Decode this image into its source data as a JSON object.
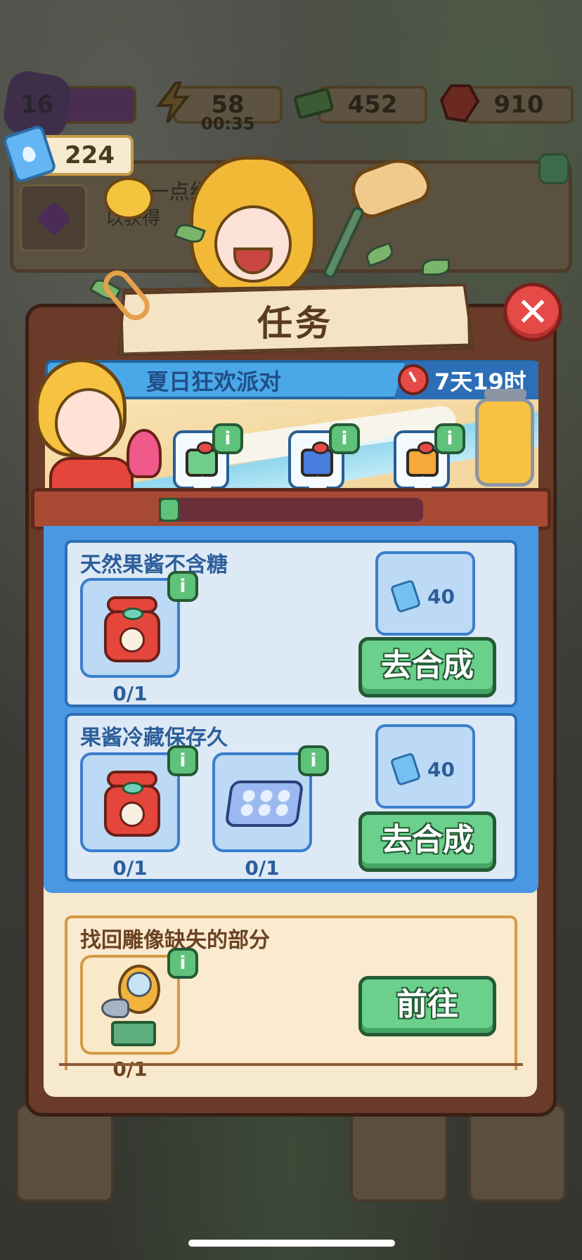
{
  "hud": {
    "level": "16",
    "energy": "58",
    "energy_timer": "00:35",
    "cash": "452",
    "gems": "910",
    "tickets": "224"
  },
  "background_quest": {
    "line1": "一点经验",
    "line2": "以获得"
  },
  "modal": {
    "title": "任务",
    "close_icon": "close-icon"
  },
  "event": {
    "name": "夏日狂欢派对",
    "time_left": "7天19时",
    "progress_fraction": 0.08,
    "gifts": [
      {
        "color": "#6fcf8a"
      },
      {
        "color": "#4a7de0"
      },
      {
        "color": "#f6a83b"
      }
    ]
  },
  "tasks": [
    {
      "title": "天然果酱不含糖",
      "items": [
        {
          "icon": "jam-jar-icon",
          "count": "0/1"
        }
      ],
      "reward": "40",
      "button": "去合成"
    },
    {
      "title": "果酱冷藏保存久",
      "items": [
        {
          "icon": "jam-jar-icon",
          "count": "0/1"
        },
        {
          "icon": "ice-tray-icon",
          "count": "0/1"
        }
      ],
      "reward": "40",
      "button": "去合成"
    },
    {
      "title": "找回雕像缺失的部分",
      "items": [
        {
          "icon": "statue-part-icon",
          "count": "0/1"
        }
      ],
      "button": "前往"
    }
  ],
  "info_label": "i"
}
